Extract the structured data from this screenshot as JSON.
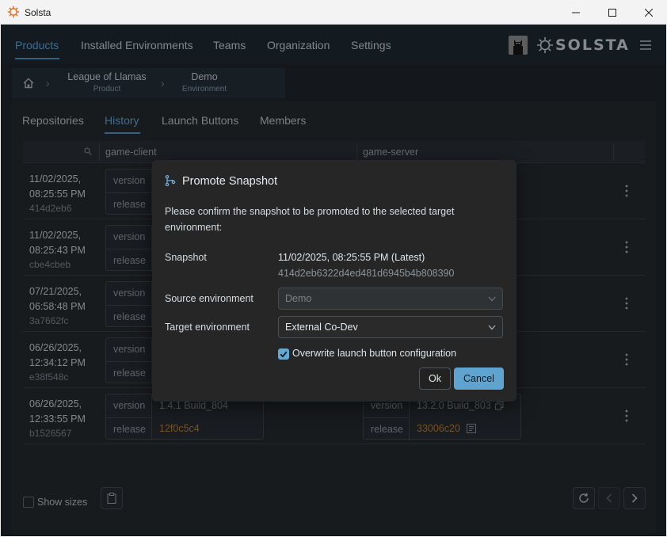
{
  "window": {
    "title": "Solsta"
  },
  "nav": {
    "items": [
      {
        "label": "Products"
      },
      {
        "label": "Installed Environments"
      },
      {
        "label": "Teams"
      },
      {
        "label": "Organization"
      },
      {
        "label": "Settings"
      }
    ],
    "brand": "SOLSTA"
  },
  "breadcrumb": [
    {
      "title": "League of Llamas",
      "subtitle": "Product"
    },
    {
      "title": "Demo",
      "subtitle": "Environment"
    }
  ],
  "tabs": [
    {
      "label": "Repositories"
    },
    {
      "label": "History"
    },
    {
      "label": "Launch Buttons"
    },
    {
      "label": "Members"
    }
  ],
  "table": {
    "columns": [
      "game-client",
      "game-server"
    ],
    "rows": [
      {
        "date": "11/02/2025, 08:25:55 PM",
        "hash": "414d2eb6"
      },
      {
        "date": "11/02/2025, 08:25:43 PM",
        "hash": "cbe4cbeb"
      },
      {
        "date": "07/21/2025, 06:58:48 PM",
        "hash": "3a7662fc"
      },
      {
        "date": "06/26/2025, 12:34:12 PM",
        "hash": "e38f548c"
      },
      {
        "date": "06/26/2025, 12:33:55 PM",
        "hash": "b1526567",
        "client_version": "1.4.1 Build_804",
        "client_release": "12f0c5c4",
        "server_version": "13.2.0 Build_803",
        "server_release": "33006c20"
      }
    ],
    "key_version": "version",
    "key_release": "release"
  },
  "footer": {
    "show_sizes": "Show sizes"
  },
  "dialog": {
    "title": "Promote Snapshot",
    "message": "Please confirm the snapshot to be promoted to the selected target environment:",
    "snapshot_label": "Snapshot",
    "snapshot_value": "11/02/2025, 08:25:55 PM (Latest)",
    "snapshot_hash": "414d2eb6322d4ed481d6945b4b808390",
    "source_label": "Source environment",
    "source_value": "Demo",
    "target_label": "Target environment",
    "target_value": "External Co-Dev",
    "overwrite_label": "Overwrite launch button configuration",
    "overwrite_checked": true,
    "ok": "Ok",
    "cancel": "Cancel"
  },
  "colors": {
    "accent": "#5aa3d6",
    "release_hash": "#b97a2c",
    "dialog_bg": "#262626"
  }
}
